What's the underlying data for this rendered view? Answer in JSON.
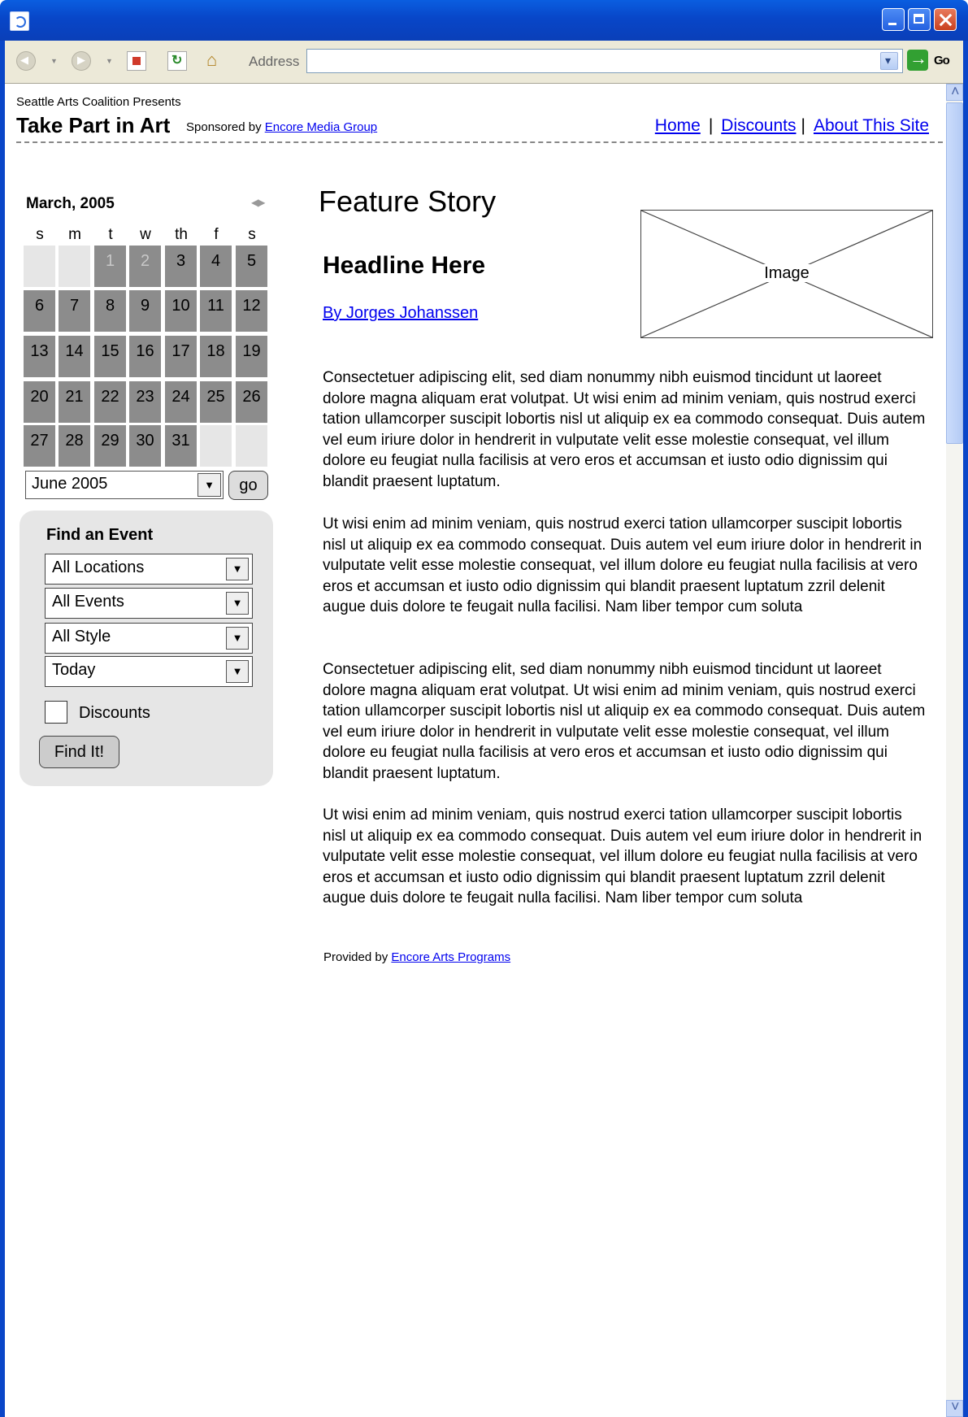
{
  "toolbar": {
    "address_label": "Address",
    "address_value": "",
    "go_label": "Go"
  },
  "header": {
    "presents": "Seattle Arts Coalition Presents",
    "title": "Take Part in Art",
    "sponsored_prefix": "Sponsored by ",
    "sponsor_link": "Encore Media Group",
    "nav": [
      "Home",
      "Discounts",
      "About This Site"
    ]
  },
  "calendar": {
    "month_title": "March, 2005",
    "weekdays": [
      "s",
      "m",
      "t",
      "w",
      "th",
      "f",
      "s"
    ],
    "weeks": [
      [
        null,
        null,
        {
          "d": "1",
          "dim": true
        },
        {
          "d": "2",
          "dim": true
        },
        {
          "d": "3"
        },
        {
          "d": "4"
        },
        {
          "d": "5"
        }
      ],
      [
        {
          "d": "6"
        },
        {
          "d": "7"
        },
        {
          "d": "8"
        },
        {
          "d": "9"
        },
        {
          "d": "10"
        },
        {
          "d": "11"
        },
        {
          "d": "12"
        }
      ],
      [
        {
          "d": "13"
        },
        {
          "d": "14"
        },
        {
          "d": "15"
        },
        {
          "d": "16"
        },
        {
          "d": "17"
        },
        {
          "d": "18"
        },
        {
          "d": "19"
        }
      ],
      [
        {
          "d": "20"
        },
        {
          "d": "21"
        },
        {
          "d": "22"
        },
        {
          "d": "23"
        },
        {
          "d": "24"
        },
        {
          "d": "25"
        },
        {
          "d": "26"
        }
      ],
      [
        {
          "d": "27"
        },
        {
          "d": "28"
        },
        {
          "d": "29"
        },
        {
          "d": "30"
        },
        {
          "d": "31"
        },
        null,
        null
      ]
    ],
    "month_select_value": "June 2005",
    "go_label": "go"
  },
  "find_event": {
    "title": "Find an Event",
    "location": "All Locations",
    "events": "All Events",
    "style": "All Style",
    "date": "Today",
    "discounts_label": "Discounts",
    "discounts_checked": false,
    "button_label": "Find It!"
  },
  "main": {
    "section_title": "Feature Story",
    "headline": "Headline Here",
    "byline": "By Jorges Johanssen",
    "image_label": "Image",
    "paragraphs": [
      "Consectetuer adipiscing elit, sed diam nonummy nibh euismod tincidunt ut laoreet dolore magna aliquam erat volutpat. Ut wisi enim ad minim veniam, quis nostrud exerci tation ullamcorper suscipit lobortis nisl ut aliquip ex ea commodo consequat. Duis autem vel eum iriure dolor in hendrerit in vulputate velit esse molestie consequat, vel illum dolore eu feugiat nulla facilisis at vero eros et accumsan et iusto odio dignissim qui blandit praesent luptatum.",
      "Ut wisi enim ad minim veniam, quis nostrud exerci tation ullamcorper suscipit lobortis nisl ut aliquip ex ea commodo consequat. Duis autem vel eum iriure dolor in hendrerit in vulputate velit esse molestie consequat, vel illum dolore eu feugiat nulla facilisis at vero eros et accumsan et iusto odio dignissim qui blandit praesent luptatum zzril delenit augue duis dolore te feugait nulla facilisi. Nam liber tempor cum soluta",
      "Consectetuer adipiscing elit, sed diam nonummy nibh euismod tincidunt ut laoreet dolore magna aliquam erat volutpat. Ut wisi enim ad minim veniam, quis nostrud exerci tation ullamcorper suscipit lobortis nisl ut aliquip ex ea commodo consequat. Duis autem vel eum iriure dolor in hendrerit in vulputate velit esse molestie consequat, vel illum dolore eu feugiat nulla facilisis at vero eros et accumsan et iusto odio dignissim qui blandit praesent luptatum.",
      "Ut wisi enim ad minim veniam, quis nostrud exerci tation ullamcorper suscipit lobortis nisl ut aliquip ex ea commodo consequat. Duis autem vel eum iriure dolor in hendrerit in vulputate velit esse molestie consequat, vel illum dolore eu feugiat nulla facilisis at vero eros et accumsan et iusto odio dignissim qui blandit praesent luptatum zzril delenit augue duis dolore te feugait nulla facilisi. Nam liber tempor cum soluta"
    ],
    "provided_prefix": "Provided by ",
    "provided_link": "Encore Arts Programs"
  }
}
